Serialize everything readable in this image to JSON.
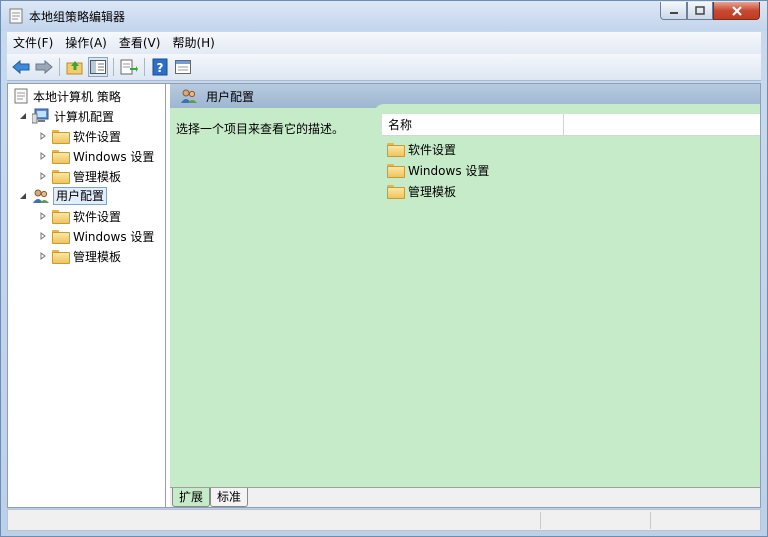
{
  "window": {
    "title": "本地组策略编辑器"
  },
  "menubar": {
    "items": [
      "文件(F)",
      "操作(A)",
      "查看(V)",
      "帮助(H)"
    ]
  },
  "toolbar": {
    "icons": [
      "back-arrow-icon",
      "forward-arrow-icon",
      "up-folder-icon",
      "show-hide-tree-icon",
      "export-list-icon",
      "help-icon",
      "properties-icon"
    ]
  },
  "tree": {
    "root": "本地计算机 策略",
    "computer_config": "计算机配置",
    "user_config": "用户配置",
    "computer_children": [
      "软件设置",
      "Windows 设置",
      "管理模板"
    ],
    "user_children": [
      "软件设置",
      "Windows 设置",
      "管理模板"
    ]
  },
  "rightpane": {
    "header": "用户配置",
    "description": "选择一个项目来查看它的描述。",
    "column_name": "名称",
    "items": [
      "软件设置",
      "Windows 设置",
      "管理模板"
    ]
  },
  "tabs": {
    "extended": "扩展",
    "standard": "标准"
  },
  "colors": {
    "pane_green": "#c6ebc9",
    "header_blue": "#9fb6d0",
    "selection_border": "#7da2ce"
  }
}
